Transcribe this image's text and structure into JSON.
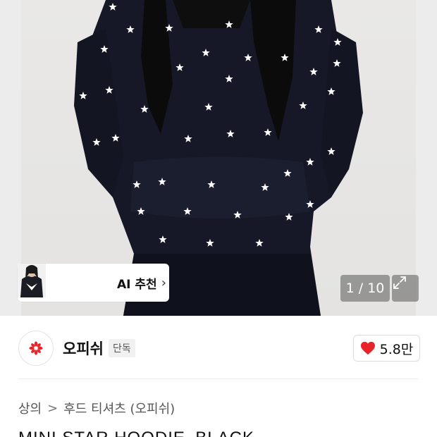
{
  "gallery": {
    "pager_text": "1 / 10",
    "ai_recommend_label": "AI 추천",
    "thumbnails": [
      "thumbnail-1",
      "thumbnail-2",
      "thumbnail-3"
    ],
    "colors": {
      "hoodie": "#161827",
      "star": "#ffffff",
      "hair": "#0b0b0b",
      "background": "#e7e6e4"
    }
  },
  "brand": {
    "name": "오피쉬",
    "badge": "단독",
    "logo_color": "#e8232a"
  },
  "likes": {
    "count": "5.8만",
    "heart_color": "#e8232a"
  },
  "breadcrumb": {
    "items": [
      "상의",
      "후드 티셔츠 (오피쉬)"
    ],
    "separator": ">"
  },
  "product": {
    "title": "MINI STAR HOODIE_BLACK"
  }
}
